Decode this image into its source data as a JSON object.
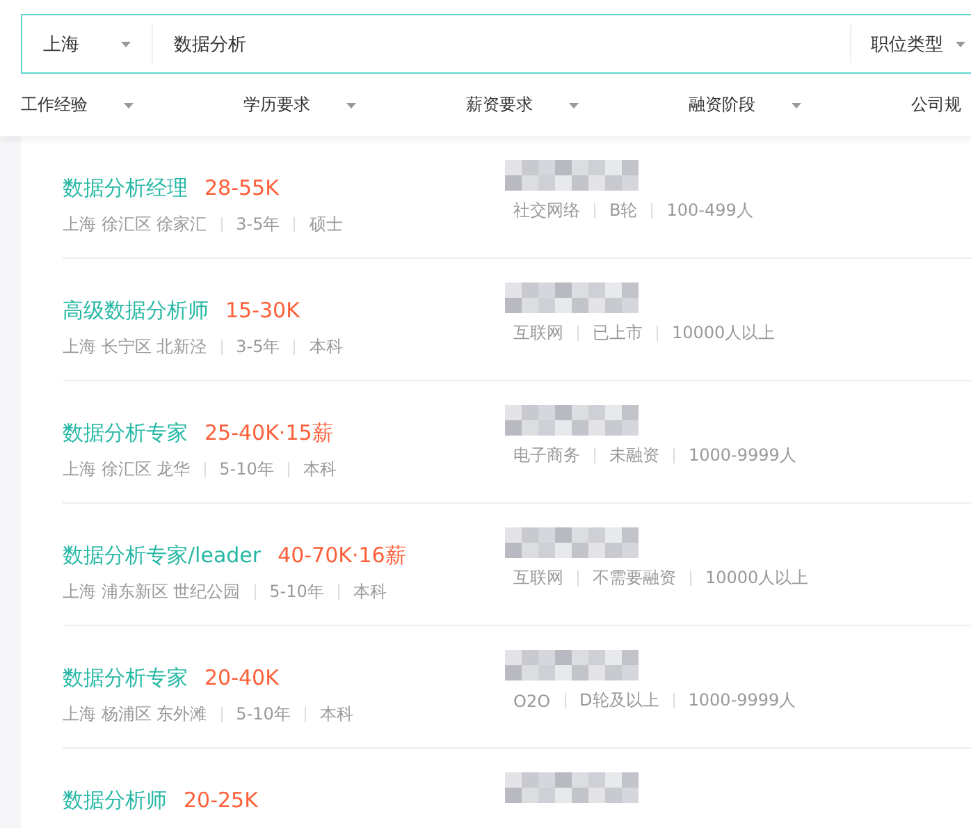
{
  "search": {
    "city": "上海",
    "query": "数据分析",
    "category": "职位类型"
  },
  "filters": [
    {
      "label": "工作经验"
    },
    {
      "label": "学历要求"
    },
    {
      "label": "薪资要求"
    },
    {
      "label": "融资阶段"
    },
    {
      "label": "公司规"
    }
  ],
  "jobs": [
    {
      "title": "数据分析经理",
      "salary": "28-55K",
      "location": "上海 徐汇区 徐家汇",
      "experience": "3-5年",
      "education": "硕士",
      "company_tags": [
        "社交网络",
        "B轮",
        "100-499人"
      ]
    },
    {
      "title": "高级数据分析师",
      "salary": "15-30K",
      "location": "上海 长宁区 北新泾",
      "experience": "3-5年",
      "education": "本科",
      "company_tags": [
        "互联网",
        "已上市",
        "10000人以上"
      ]
    },
    {
      "title": "数据分析专家",
      "salary": "25-40K·15薪",
      "location": "上海 徐汇区 龙华",
      "experience": "5-10年",
      "education": "本科",
      "company_tags": [
        "电子商务",
        "未融资",
        "1000-9999人"
      ]
    },
    {
      "title": "数据分析专家/leader",
      "salary": "40-70K·16薪",
      "location": "上海 浦东新区 世纪公园",
      "experience": "5-10年",
      "education": "本科",
      "company_tags": [
        "互联网",
        "不需要融资",
        "10000人以上"
      ]
    },
    {
      "title": "数据分析专家",
      "salary": "20-40K",
      "location": "上海 杨浦区 东外滩",
      "experience": "5-10年",
      "education": "本科",
      "company_tags": [
        "O2O",
        "D轮及以上",
        "1000-9999人"
      ]
    },
    {
      "title": "数据分析师",
      "salary": "20-25K"
    }
  ]
}
